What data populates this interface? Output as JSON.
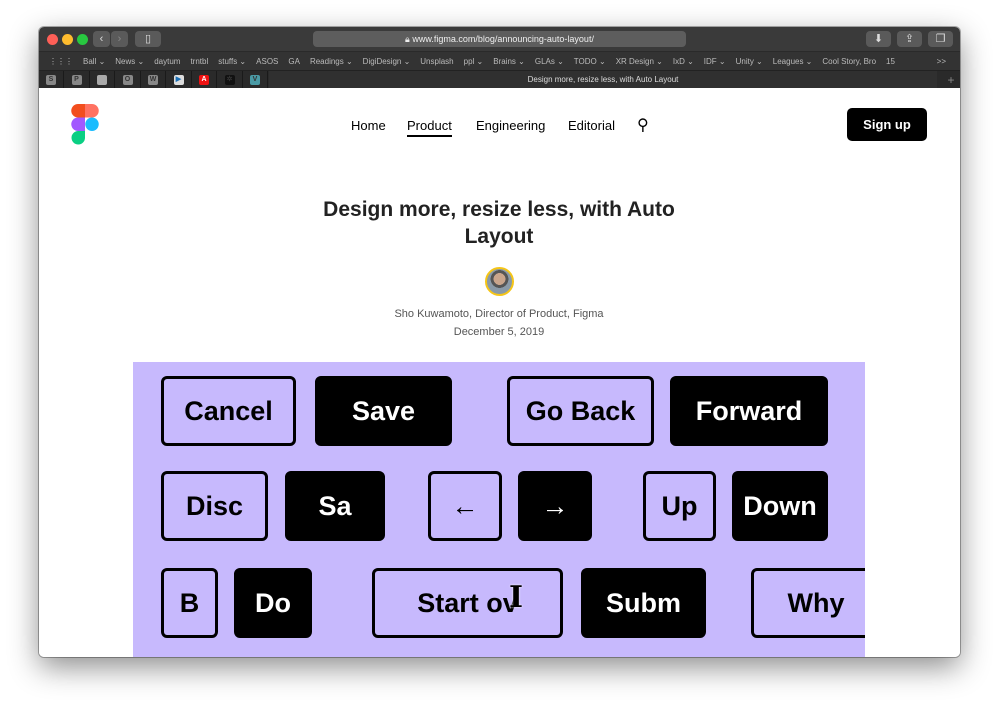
{
  "browser": {
    "url": "www.figma.com/blog/announcing-auto-layout/",
    "tab_title": "Design more, resize less, with Auto Layout",
    "bookmarks": [
      "Ball ⌄",
      "News ⌄",
      "daytum",
      "trntbl",
      "stuffs ⌄",
      "ASOS",
      "GA",
      "Readings ⌄",
      "DigiDesign ⌄",
      "Unsplash",
      "ppl ⌄",
      "Brains ⌄",
      "GLAs ⌄",
      "TODO ⌄",
      "XR Design ⌄",
      "IxD ⌄",
      "IDF ⌄",
      "Unity ⌄",
      "Leagues ⌄",
      "Cool Story, Bro",
      "15"
    ],
    "pinned_tabs": [
      "S",
      "P",
      "",
      "O",
      "W",
      "▶",
      "A",
      "✲",
      "V"
    ],
    "overflow": ">>",
    "new_tab": "+"
  },
  "nav": {
    "items": [
      "Home",
      "Product",
      "Engineering",
      "Editorial"
    ],
    "active": "Product",
    "signup": "Sign up"
  },
  "article": {
    "title": "Design more, resize less, with Auto Layout",
    "author": "Sho Kuwamoto, Director of Product, Figma",
    "date": "December 5, 2019"
  },
  "hero": {
    "background": "#c7b9fd",
    "buttons": [
      "Cancel",
      "Save",
      "Go Back",
      "Forward",
      "Disc",
      "Sa",
      "←",
      "→",
      "Up",
      "Down",
      "B",
      "Do",
      "Start ov",
      "Subm",
      "Why"
    ]
  }
}
